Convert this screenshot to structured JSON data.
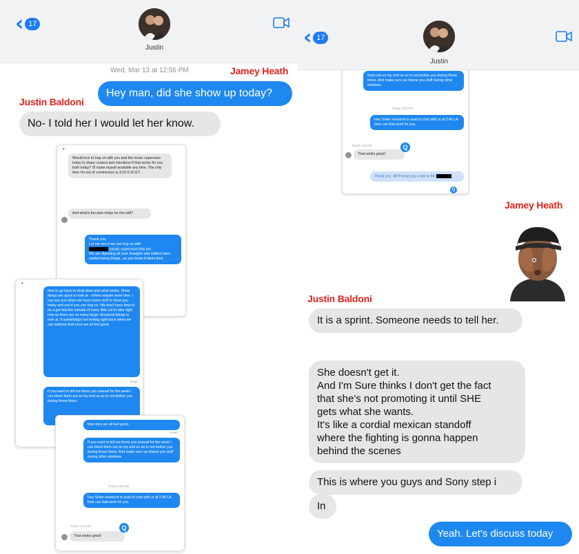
{
  "left": {
    "header": {
      "back_count": "17",
      "contact_name": "Justin"
    },
    "timestamp": "Wed, Mar 13 at 12:56 PM",
    "label_sender_out": "Jamey Heath",
    "label_sender_in": "Justin Baldoni",
    "messages": {
      "m1": "Hey man, did she show up today?",
      "m2": "No- I told her I would let her know."
    },
    "embedded": {
      "s1_in": "Would love to hop on with you and the music supervisor today to share context and intentions if that works for you both today? I'll make myself available any time. The only time I'm out of commission is 3:15-5:15 ET.",
      "s1_in2": "And what's the plan today for the edit?",
      "s1_out_a": "Thank you.",
      "s1_out_b": "Let me see if we can hop on with",
      "s1_out_c": "(music supervisor) this pm.",
      "s1_out_d": "We are digesting all your thoughts and editors have started trying things...as you know it takes time.",
      "s2_out": "time to go back to what does and what works. Show things are quick to look at - others require more time. I can see you when we have some stuff to show you today and see if you can hop on. We don't have time to do a get fast the minutia of every little cut to take right now so there are so many larger structural things to look at. If something's not feeling right back when we can address that once we all feel good.",
      "s2_read": "Read",
      "s2_out2": "If you want to tell me times you unavail for the week I can block them out so my end so as to not bother you during those times.",
      "s3_out_top": "that once we all feel good.",
      "s3_read": "Read",
      "s3_out": "If you want to tell me times you unavail for the week I can block them out on my end so as to not bother you during those times. And make sure we blame you stuff during other windows.",
      "s3_today": "Today 2:03 PM",
      "s3_out2": "Hey Sister research is avail to chat with ur at 2:45 LA time can that work for you",
      "s3_in": "That works great!",
      "s3_time": "Read 1:45 PM"
    }
  },
  "right": {
    "header": {
      "back_count": "17",
      "contact_name": "Justin"
    },
    "label_sender_out": "Jamey Heath",
    "label_sender_in": "Justin Baldoni",
    "embedded": {
      "r_out1": "them out on my end so as to not bother you during those times. And make sure we blame you stuff during other windows.",
      "r_today": "Today 2:03 PM",
      "r_out2": "Hey Sister research is avail to chat with ur at 2:45 LA time can that work for you.",
      "r_in": "That works great!",
      "r_in_time": "Read 1:45 PM",
      "r_out3": "Thank you. We'll send you a link to the"
    },
    "messages": {
      "m1": "It is a sprint. Someone needs to tell her.",
      "m2_lines": [
        "She doesn't get it.",
        "And I'm Sure thinks I don't get the fact",
        "that she's not promoting it until SHE",
        "gets what she wants.",
        "It's like a cordial mexican standoff",
        "where the fighting is gonna happen",
        "behind the scenes"
      ],
      "m3": "This is where you guys and Sony step i",
      "m4": "In",
      "m5": "Yeah. Let's discuss today"
    }
  },
  "colors": {
    "imessage_blue": "#1e88f0",
    "incoming_grey": "#e6e6e8",
    "label_red": "#e0221c",
    "link_blue": "#1d7bf6"
  }
}
